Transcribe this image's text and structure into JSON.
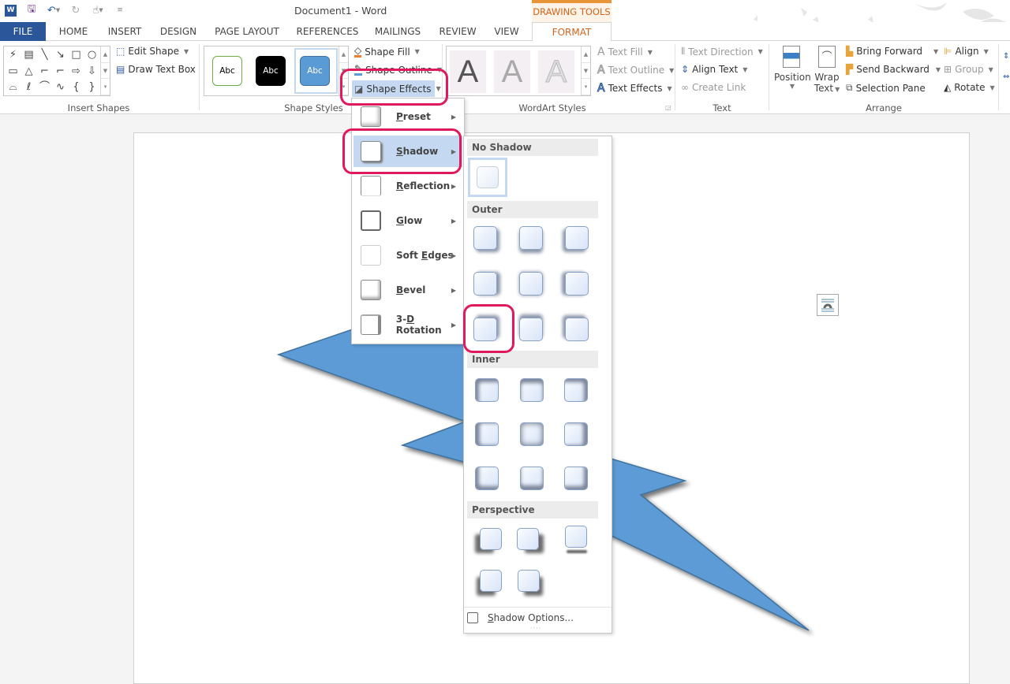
{
  "window": {
    "title": "Document1 - Word",
    "contextual_tab_group": "DRAWING TOOLS"
  },
  "quick_access": [
    {
      "icon": "word-logo-icon"
    },
    {
      "icon": "save-icon"
    },
    {
      "icon": "undo-icon"
    },
    {
      "icon": "redo-icon"
    },
    {
      "icon": "touch-mode-icon"
    },
    {
      "icon": "customize-qat-icon"
    }
  ],
  "tabs": [
    {
      "label": "FILE"
    },
    {
      "label": "HOME"
    },
    {
      "label": "INSERT"
    },
    {
      "label": "DESIGN"
    },
    {
      "label": "PAGE LAYOUT"
    },
    {
      "label": "REFERENCES"
    },
    {
      "label": "MAILINGS"
    },
    {
      "label": "REVIEW"
    },
    {
      "label": "VIEW"
    },
    {
      "label": "FORMAT",
      "active": true
    }
  ],
  "ribbon": {
    "insert_shapes": {
      "label": "Insert Shapes",
      "edit_shape": "Edit Shape",
      "draw_text_box": "Draw Text Box",
      "shapes": [
        "⚡",
        "▤",
        "╲",
        "↘",
        "□",
        "○",
        "▭",
        "△",
        "⌐",
        "⌐",
        "⇨",
        "⇩",
        "⌓",
        "ℓ",
        "⌒",
        "∿",
        "{",
        "}"
      ]
    },
    "shape_styles": {
      "label": "Shape Styles",
      "styles": [
        {
          "text": "Abc"
        },
        {
          "text": "Abc"
        },
        {
          "text": "Abc"
        }
      ],
      "shape_fill": "Shape Fill",
      "shape_outline": "Shape Outline",
      "shape_effects": "Shape Effects"
    },
    "wordart_styles": {
      "label": "WordArt Styles",
      "letters": [
        "A",
        "A",
        "A"
      ],
      "text_fill": "Text Fill",
      "text_outline": "Text Outline",
      "text_effects": "Text Effects"
    },
    "text": {
      "label": "Text",
      "text_direction": "Text Direction",
      "align_text": "Align Text",
      "create_link": "Create Link"
    },
    "arrange": {
      "label": "Arrange",
      "position": "Position",
      "wrap_text_1": "Wrap",
      "wrap_text_2": "Text",
      "bring_forward": "Bring Forward",
      "send_backward": "Send Backward",
      "selection_pane": "Selection Pane",
      "align": "Align",
      "group": "Group",
      "rotate": "Rotate"
    }
  },
  "effects_menu": {
    "items": [
      {
        "pre": "",
        "u": "P",
        "post": "reset"
      },
      {
        "pre": "",
        "u": "S",
        "post": "hadow",
        "active": true
      },
      {
        "pre": "",
        "u": "R",
        "post": "eflection"
      },
      {
        "pre": "",
        "u": "G",
        "post": "low"
      },
      {
        "pre": "Soft ",
        "u": "E",
        "post": "dges"
      },
      {
        "pre": "",
        "u": "B",
        "post": "evel"
      },
      {
        "pre": "3-",
        "u": "D",
        "post": " Rotation"
      }
    ]
  },
  "shadow_gallery": {
    "sections": [
      "No Shadow",
      "Outer",
      "Inner",
      "Perspective"
    ],
    "shadow_options_pre": "",
    "shadow_options_u": "S",
    "shadow_options_post": "hadow Options...",
    "highlighted": "Outer row 3 column 1"
  },
  "colors": {
    "accent": "#2b579a",
    "format_tab": "#d2631a",
    "highlight": "#e0195a",
    "shape_fill": "#5b9bd5",
    "shape_stroke": "#41719c"
  }
}
